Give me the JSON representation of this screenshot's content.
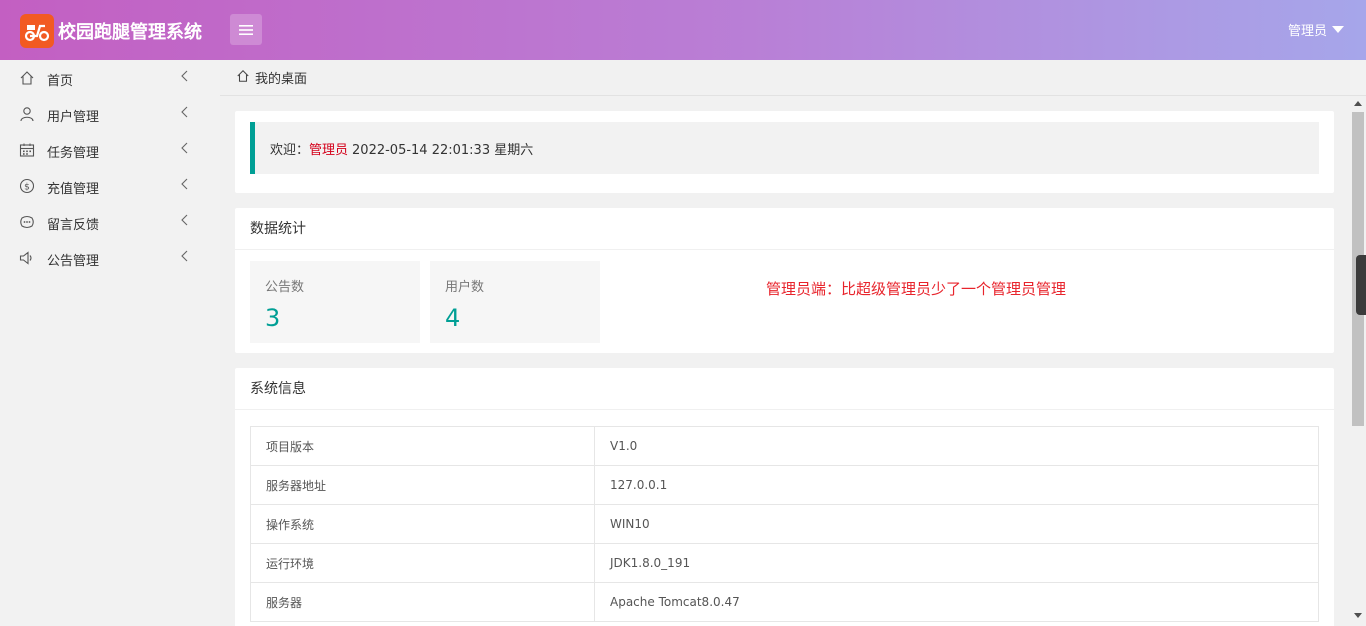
{
  "header": {
    "app_title": "校园跑腿管理系统",
    "user_label": "管理员"
  },
  "sidebar": {
    "items": [
      {
        "label": "首页",
        "icon": "home-icon"
      },
      {
        "label": "用户管理",
        "icon": "user-icon"
      },
      {
        "label": "任务管理",
        "icon": "calendar-icon"
      },
      {
        "label": "充值管理",
        "icon": "dollar-icon"
      },
      {
        "label": "留言反馈",
        "icon": "feedback-icon"
      },
      {
        "label": "公告管理",
        "icon": "speaker-icon"
      }
    ]
  },
  "breadcrumb": {
    "label": "我的桌面"
  },
  "welcome": {
    "prefix": "欢迎：",
    "role": "管理员",
    "datetime": "2022-05-14  22:01:33  星期六"
  },
  "stats": {
    "title": "数据统计",
    "items": [
      {
        "label": "公告数",
        "value": "3"
      },
      {
        "label": "用户数",
        "value": "4"
      }
    ],
    "note": "管理员端：比超级管理员少了一个管理员管理"
  },
  "sysinfo": {
    "title": "系统信息",
    "rows": [
      {
        "key": "项目版本",
        "value": "V1.0"
      },
      {
        "key": "服务器地址",
        "value": "127.0.0.1"
      },
      {
        "key": "操作系统",
        "value": "WIN10"
      },
      {
        "key": "运行环境",
        "value": "JDK1.8.0_191"
      },
      {
        "key": "服务器",
        "value": "Apache Tomcat8.0.47"
      }
    ]
  },
  "colors": {
    "header_start": "#c35fc2",
    "header_end": "#a6a6ea",
    "accent": "#009f95",
    "danger": "#e8242c",
    "logo_badge": "#f25a22"
  }
}
